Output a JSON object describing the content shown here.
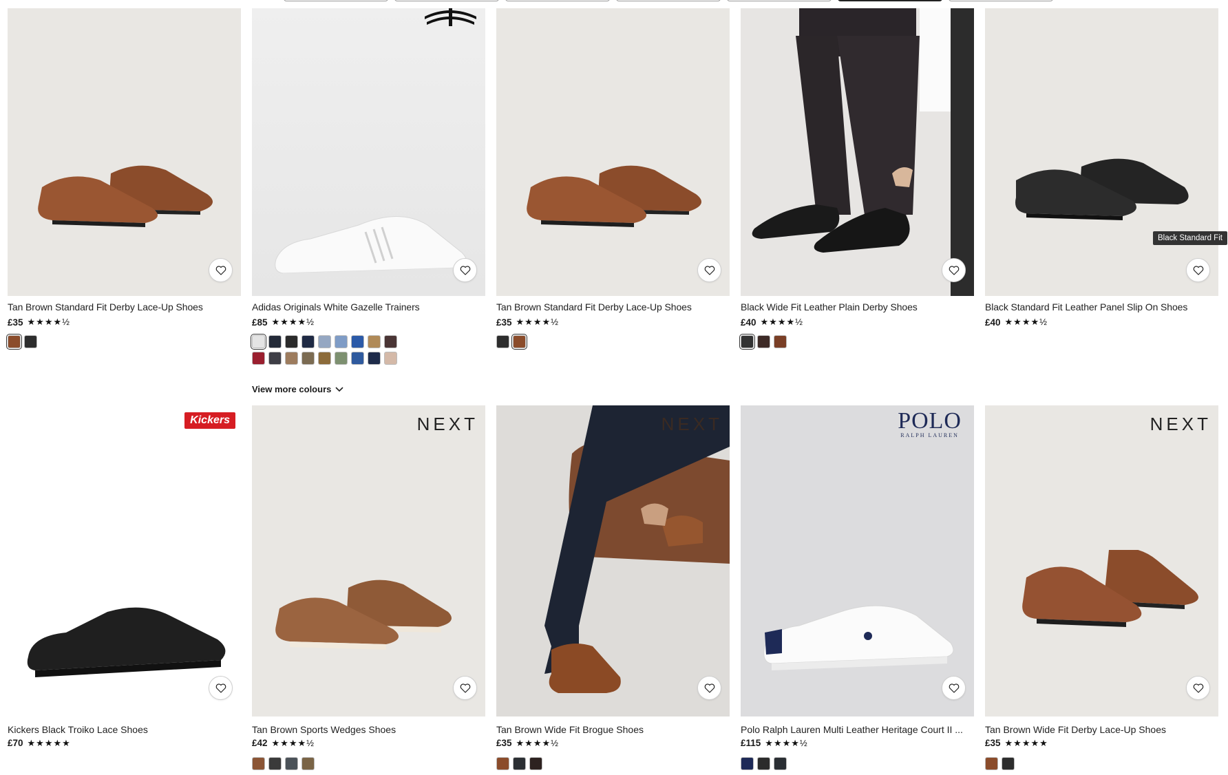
{
  "colors": {
    "tan": "#8b4c2b",
    "black": "#2a2a2a",
    "white": "#f4f4f4",
    "navy": "#1e2a57",
    "kickers_red": "#d61d23"
  },
  "wishlist_icon": "heart-outline-icon",
  "tooltip": "Black Standard Fit",
  "products_row1": [
    {
      "title": "Tan Brown Standard Fit Derby Lace-Up Shoes",
      "price": "£35",
      "stars": "★★★★½",
      "swatches": [
        "#8b4c2b",
        "#2d2d2d"
      ],
      "selected": 0
    },
    {
      "title": "Adidas Originals White Gazelle Trainers",
      "price": "£85",
      "stars": "★★★★½",
      "swatches": [
        "#e4e4e4",
        "#232a38",
        "#2b2b2b",
        "#1f2a44",
        "#95a7c2",
        "#7f9cc6",
        "#2b5aa8",
        "#b08a58",
        "#4a3535",
        "#9a1f2f",
        "#3e3e46",
        "#9d7c5e",
        "#7b6b52",
        "#8c6b3a",
        "#7d9070",
        "#2f5a9e",
        "#1e2b4a",
        "#d4b9a8"
      ],
      "selected": 0,
      "view_more": "View more colours"
    },
    {
      "title": "Tan Brown Standard Fit Derby Lace-Up Shoes",
      "price": "£35",
      "stars": "★★★★½",
      "swatches": [
        "#2d2d2d",
        "#8b4c2b"
      ],
      "selected": 1
    },
    {
      "title": "Black Wide Fit Leather Plain Derby Shoes",
      "price": "£40",
      "stars": "★★★★½",
      "swatches": [
        "#333333",
        "#3d2a26",
        "#7a3f26"
      ],
      "selected": 0
    },
    {
      "title": "Black Standard Fit Leather Panel Slip On Shoes",
      "price": "£40",
      "stars": "★★★★½",
      "swatches": [],
      "selected": -1
    }
  ],
  "products_row2": [
    {
      "title": "Kickers Black Troiko Lace Shoes",
      "price": "£70",
      "stars": "★★★★★",
      "brand": "Kickers",
      "swatches": []
    },
    {
      "title": "Tan Brown Sports Wedges Shoes",
      "price": "£42",
      "stars": "★★★★½",
      "brand": "NEXT",
      "swatches": [
        "#8b5535",
        "#3a3a3a",
        "#4b5258",
        "#7a6446"
      ]
    },
    {
      "title": "Tan Brown Wide Fit Brogue Shoes",
      "price": "£35",
      "stars": "★★★★½",
      "brand": "NEXT",
      "swatches": [
        "#8b4c2b",
        "#2b2f33",
        "#2d2220"
      ]
    },
    {
      "title": "Polo Ralph Lauren Multi Leather Heritage Court II ...",
      "price": "£115",
      "stars": "★★★★½",
      "brand": "POLO",
      "brand_sub": "RALPH LAUREN",
      "swatches": [
        "#1e2a57",
        "#2b2b2b",
        "#2a2e33"
      ]
    },
    {
      "title": "Tan Brown Wide Fit Derby Lace-Up Shoes",
      "price": "£35",
      "stars": "★★★★★",
      "brand": "NEXT",
      "swatches": [
        "#8b4c2b",
        "#2d2d2d"
      ]
    }
  ]
}
